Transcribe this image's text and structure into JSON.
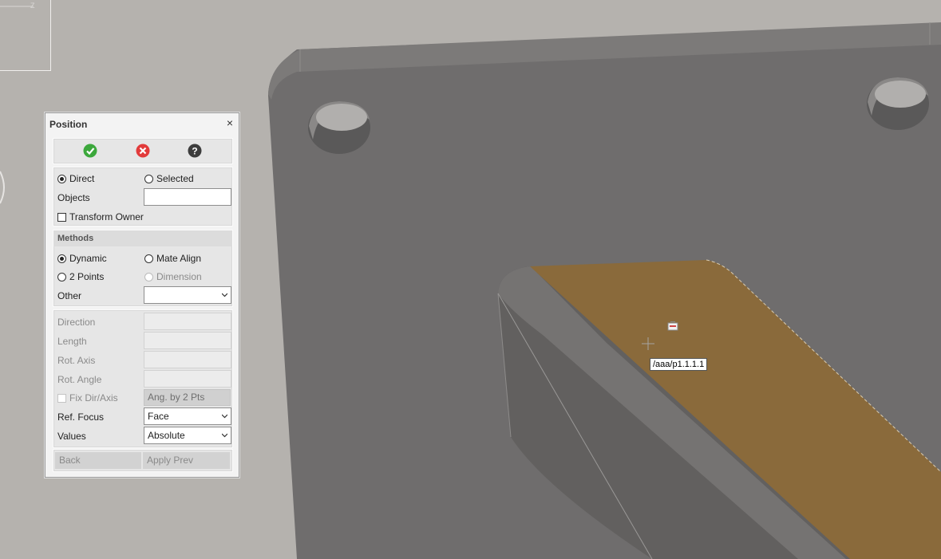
{
  "tooltip": {
    "text": "/aaa/p1.1.1.1"
  },
  "dialog": {
    "title": "Position",
    "close_glyph": "×",
    "actions": {
      "ok_icon": "check-circle-icon",
      "cancel_icon": "x-circle-icon",
      "help_icon": "help-circle-icon"
    },
    "mode": {
      "direct_label": "Direct",
      "selected_label": "Selected",
      "objects_label": "Objects",
      "objects_value": "",
      "transform_owner_label": "Transform Owner"
    },
    "methods": {
      "header": "Methods",
      "dynamic_label": "Dynamic",
      "mate_align_label": "Mate Align",
      "two_points_label": "2 Points",
      "dimension_label": "Dimension",
      "other_label": "Other",
      "other_value": ""
    },
    "params": {
      "direction_label": "Direction",
      "length_label": "Length",
      "rot_axis_label": "Rot. Axis",
      "rot_angle_label": "Rot. Angle",
      "fix_dir_label": "Fix Dir/Axis",
      "ang_btn_label": "Ang. by 2 Pts",
      "ref_focus_label": "Ref. Focus",
      "ref_focus_value": "Face",
      "values_label": "Values",
      "values_value": "Absolute"
    },
    "buttons": {
      "back_label": "Back",
      "apply_prev_label": "Apply Prev"
    }
  },
  "colors": {
    "face_highlight": "#8a6a3b",
    "part_gray": "#6e6c6c",
    "background": "#b5b2ae"
  }
}
